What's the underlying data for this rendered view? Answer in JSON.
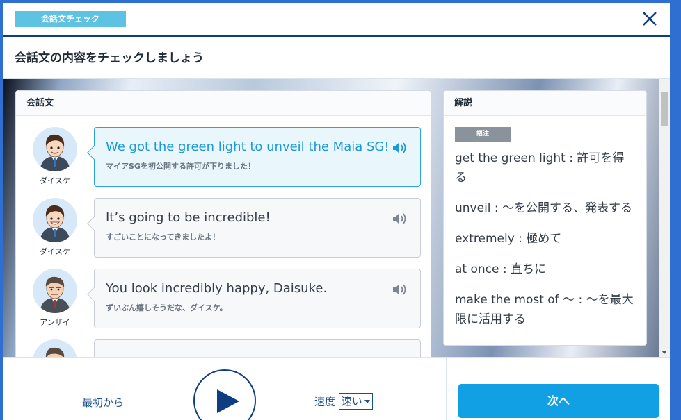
{
  "header": {
    "badge": "会話文チェック",
    "title": "会話文の内容をチェックしましょう"
  },
  "conversation": {
    "heading": "会話文",
    "lines": [
      {
        "speaker": "ダイスケ",
        "en": "We got the green light to unveil the Maia SG!",
        "ja": "マイアSGを初公開する許可が下りました！",
        "active": true
      },
      {
        "speaker": "ダイスケ",
        "en": "It’s going to be incredible!",
        "ja": "すごいことになってきましたよ！",
        "active": false
      },
      {
        "speaker": "アンザイ",
        "en": "You look incredibly happy, Daisuke.",
        "ja": "ずいぶん嬉しそうだな、ダイスケ。",
        "active": false
      }
    ]
  },
  "explanation": {
    "heading": "解説",
    "tag": "語注",
    "items": [
      "get the green light : 許可を得る",
      "unveil : 〜を公開する、発表する",
      "extremely : 極めて",
      "at once : 直ちに",
      "make the most of 〜 : 〜を最大限に活用する"
    ]
  },
  "footer": {
    "from_start": "最初から",
    "speed_label": "速度",
    "speed_value": "速い",
    "next": "次へ"
  },
  "colors": {
    "accent": "#11a0e3",
    "navy": "#0f3d82",
    "active_text": "#1a9ad6",
    "badge": "#5ec2e2"
  }
}
